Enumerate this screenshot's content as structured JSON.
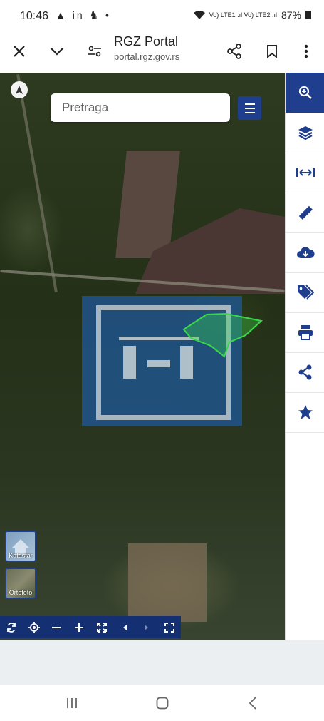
{
  "status": {
    "time": "10:46",
    "left_icons": "▲ in ♞ •",
    "signal_text": "Vo) LTE1 .ıl Vo) LTE2 .ıl",
    "battery": "87%"
  },
  "browser": {
    "title": "RGZ Portal",
    "url": "portal.rgz.gov.rs"
  },
  "map": {
    "search_placeholder": "Pretraga",
    "layers": [
      {
        "label": "Katastar"
      },
      {
        "label": "Ortofoto"
      }
    ]
  },
  "colors": {
    "brand": "#1f3f8e",
    "toolbar": "#152f73",
    "parcel": "#39d94a"
  },
  "sidebar": {
    "items": [
      {
        "icon": "search-zoom-icon",
        "active": true
      },
      {
        "icon": "layers-icon"
      },
      {
        "icon": "measure-distance-icon"
      },
      {
        "icon": "ruler-icon"
      },
      {
        "icon": "cloud-download-icon"
      },
      {
        "icon": "tags-icon"
      },
      {
        "icon": "print-icon"
      },
      {
        "icon": "share-icon"
      },
      {
        "icon": "star-icon"
      }
    ]
  },
  "toolbar": {
    "items": [
      "refresh-icon",
      "locate-icon",
      "zoom-out-icon",
      "zoom-in-icon",
      "full-extent-icon",
      "previous-extent-icon",
      "next-extent-icon",
      "fullscreen-icon"
    ]
  }
}
